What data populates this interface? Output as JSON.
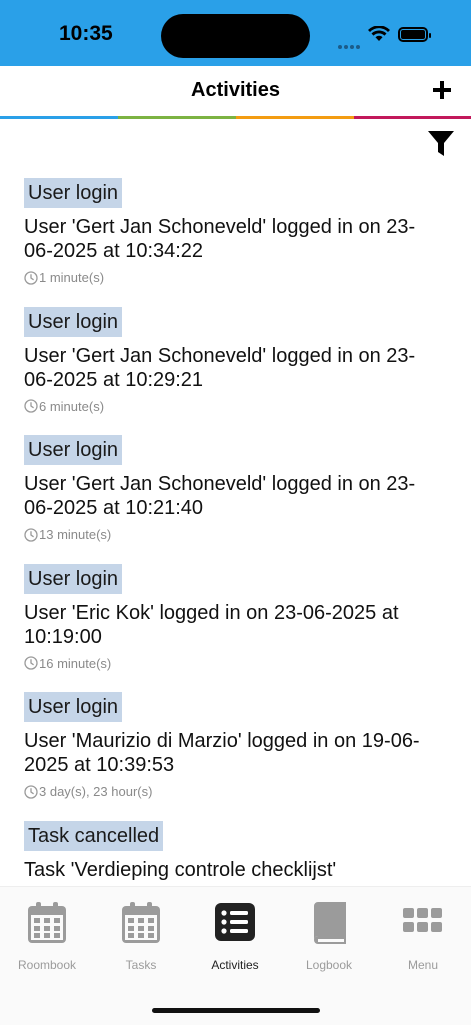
{
  "status_bar": {
    "time": "10:35"
  },
  "nav": {
    "title": "Activities",
    "add_icon": "plus-icon",
    "filter_icon": "filter-icon"
  },
  "activities": [
    {
      "type": "User login",
      "message": "User 'Gert Jan Schoneveld' logged in on 23-06-2025 at 10:34:22",
      "ago": "1 minute(s)"
    },
    {
      "type": "User login",
      "message": "User 'Gert Jan Schoneveld' logged in on 23-06-2025 at 10:29:21",
      "ago": "6 minute(s)"
    },
    {
      "type": "User login",
      "message": "User 'Gert Jan Schoneveld' logged in on 23-06-2025 at 10:21:40",
      "ago": "13 minute(s)"
    },
    {
      "type": "User login",
      "message": "User 'Eric Kok' logged in on 23-06-2025 at 10:19:00",
      "ago": "16 minute(s)"
    },
    {
      "type": "User login",
      "message": "User 'Maurizio di Marzio' logged in on 19-06-2025 at 10:39:53",
      "ago": "3 day(s), 23 hour(s)"
    },
    {
      "type": "Task cancelled",
      "message": "Task 'Verdieping controle checklijst'",
      "ago": ""
    }
  ],
  "tabbar": {
    "tabs": [
      {
        "label": "Roombook",
        "icon": "calendar-icon"
      },
      {
        "label": "Tasks",
        "icon": "calendar-icon"
      },
      {
        "label": "Activities",
        "icon": "list-icon"
      },
      {
        "label": "Logbook",
        "icon": "book-icon"
      },
      {
        "label": "Menu",
        "icon": "grid-icon"
      }
    ]
  },
  "colors": {
    "status_bar": "#2aa0e8",
    "tag_bg": "#c5d5e8",
    "active_tab": "#222222",
    "inactive_tab": "#9b9b9b"
  }
}
